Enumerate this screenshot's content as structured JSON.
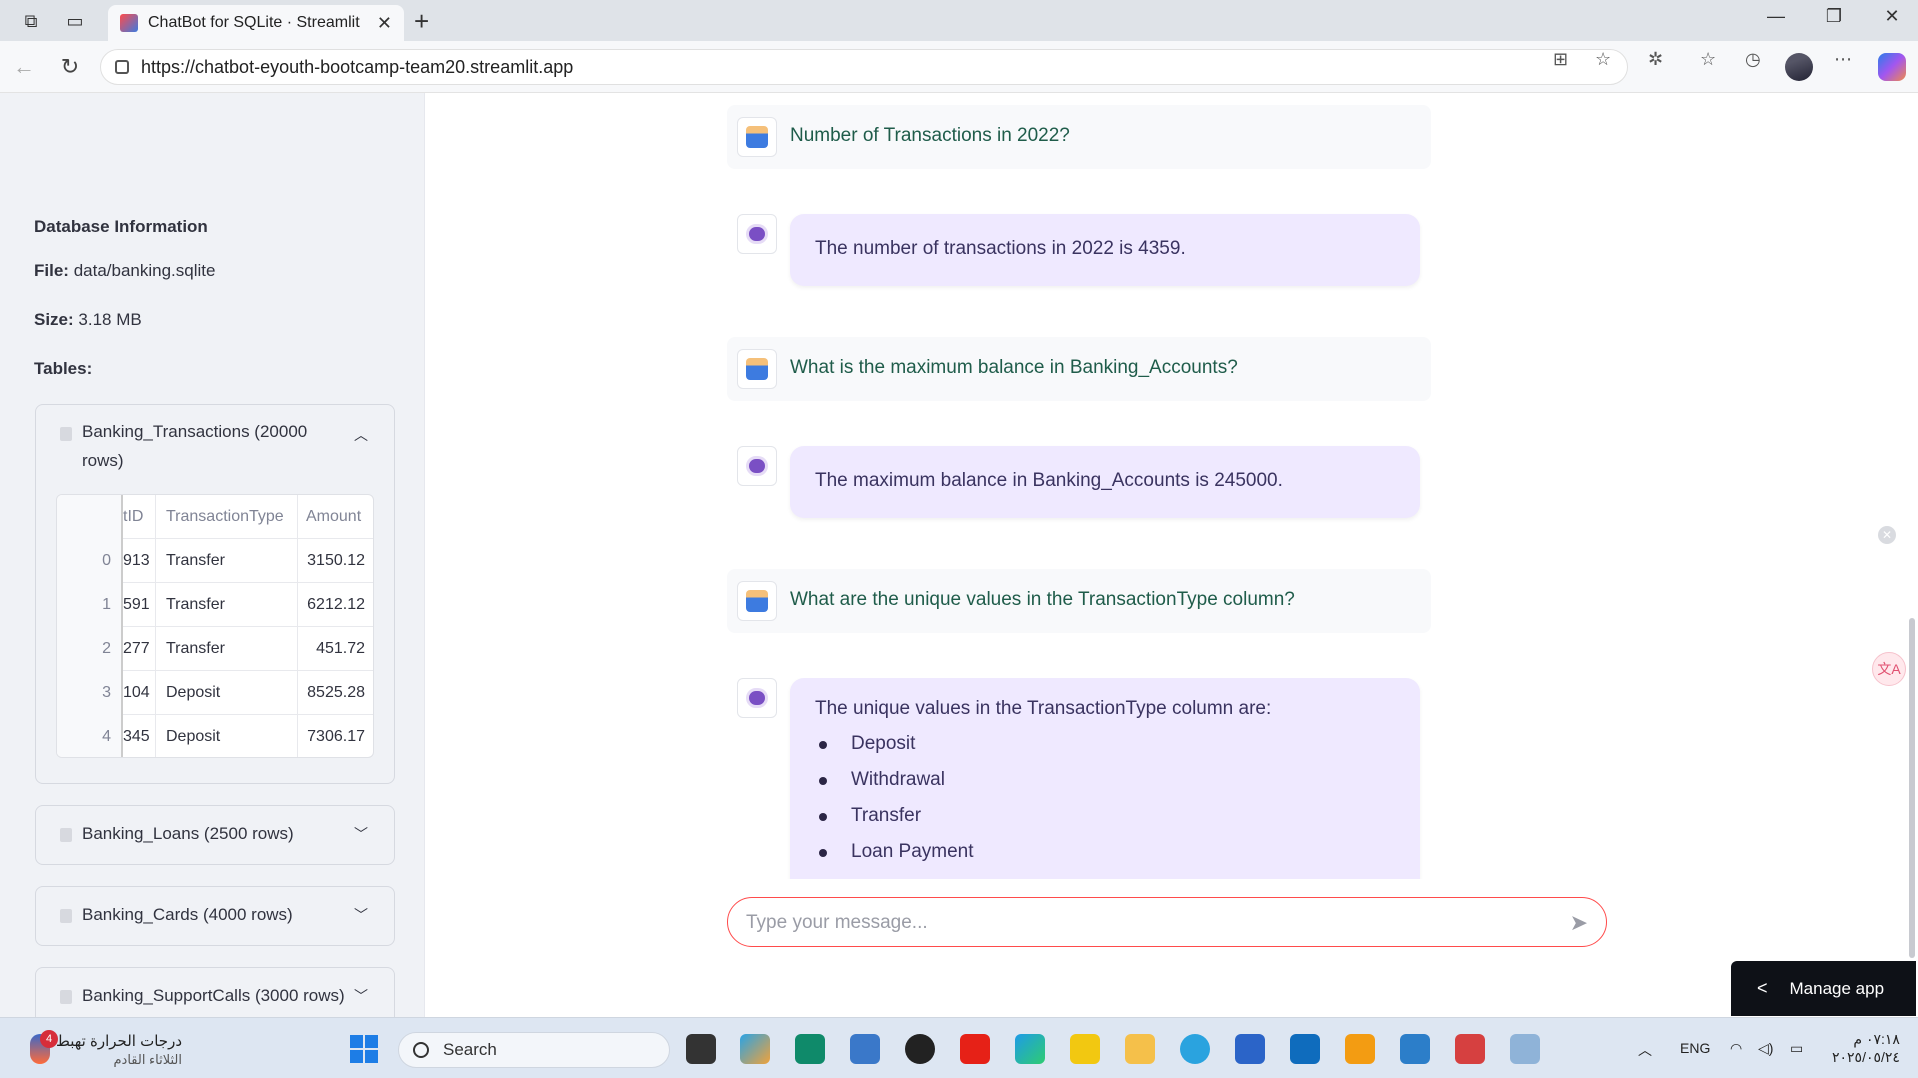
{
  "browser": {
    "tab_title": "ChatBot for SQLite · Streamlit",
    "url": "https://chatbot-eyouth-bootcamp-team20.streamlit.app"
  },
  "sidebar": {
    "heading": "Database Information",
    "file_label": "File:",
    "file_value": "data/banking.sqlite",
    "size_label": "Size:",
    "size_value": "3.18 MB",
    "tables_label": "Tables:",
    "expanded_table": {
      "title": "Banking_Transactions (20000 rows)",
      "columns": [
        "",
        "tID",
        "TransactionType",
        "Amount"
      ],
      "rows": [
        [
          "0",
          "913",
          "Transfer",
          "3150.12"
        ],
        [
          "1",
          "591",
          "Transfer",
          "6212.12"
        ],
        [
          "2",
          "277",
          "Transfer",
          "451.72"
        ],
        [
          "3",
          "104",
          "Deposit",
          "8525.28"
        ],
        [
          "4",
          "345",
          "Deposit",
          "7306.17"
        ]
      ]
    },
    "collapsed_tables": [
      "Banking_Loans (2500 rows)",
      "Banking_Cards (4000 rows)",
      "Banking_SupportCalls (3000 rows)"
    ]
  },
  "chat": {
    "messages": [
      {
        "role": "user",
        "text": "Number of Transactions in 2022?"
      },
      {
        "role": "assistant",
        "text": "The number of transactions in 2022 is 4359."
      },
      {
        "role": "user",
        "text": "What is the maximum balance in Banking_Accounts?"
      },
      {
        "role": "assistant",
        "text": "The maximum balance in Banking_Accounts is 245000."
      },
      {
        "role": "user",
        "text": "What are the unique values in the TransactionType column?"
      },
      {
        "role": "assistant",
        "text": "The unique values in the TransactionType column are:",
        "items": [
          "Deposit",
          "Withdrawal",
          "Transfer",
          "Loan Payment"
        ]
      }
    ],
    "input_placeholder": "Type your message..."
  },
  "manage_app_label": "Manage app",
  "taskbar": {
    "weather_line1": "درجات الحرارة تهبط",
    "weather_line2": "الثلاثاء القادم",
    "weather_badge": "4",
    "search_label": "Search",
    "language": "ENG",
    "time": "٠٧:١٨ م",
    "date": "٢٠٢٥/٠٥/٢٤"
  },
  "colors": {
    "accent": "#ff4b4b",
    "assistant_bubble": "#efe9ff",
    "user_text": "#1f5c4a",
    "sidebar_bg": "#f0f2f6"
  }
}
